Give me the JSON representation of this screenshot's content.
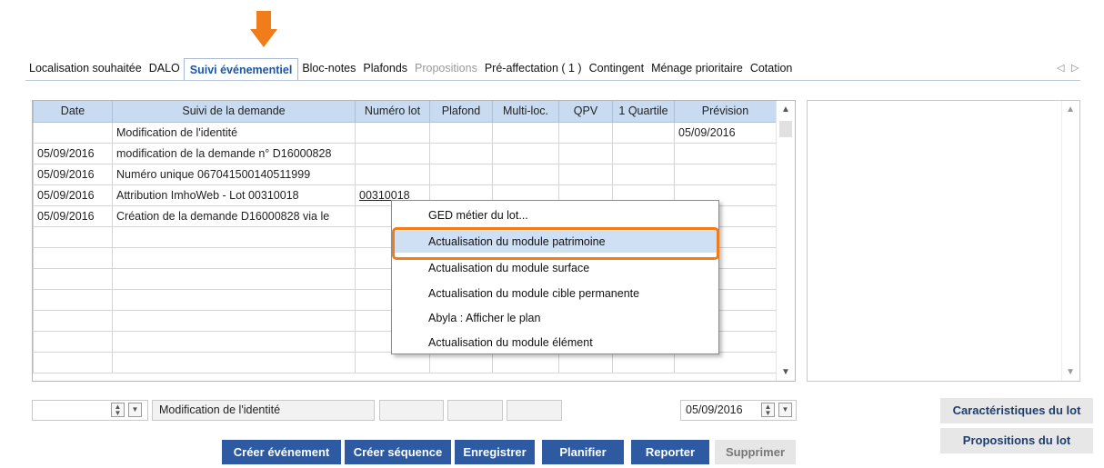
{
  "tabs": [
    {
      "label": "Localisation souhaitée",
      "state": "normal"
    },
    {
      "label": "DALO",
      "state": "normal"
    },
    {
      "label": "Suivi événementiel",
      "state": "active"
    },
    {
      "label": "Bloc-notes",
      "state": "normal"
    },
    {
      "label": "Plafonds",
      "state": "normal"
    },
    {
      "label": "Propositions",
      "state": "disabled"
    },
    {
      "label": "Pré-affectation ( 1 )",
      "state": "normal"
    },
    {
      "label": "Contingent",
      "state": "normal"
    },
    {
      "label": "Ménage prioritaire",
      "state": "normal"
    },
    {
      "label": "Cotation",
      "state": "normal"
    }
  ],
  "tab_nav": {
    "prev": "◁",
    "next": "▷"
  },
  "grid": {
    "columns": [
      "Date",
      "Suivi de la demande",
      "Numéro lot",
      "Plafond",
      "Multi-loc.",
      "QPV",
      "1 Quartile",
      "Prévision"
    ],
    "rows": [
      [
        "",
        "Modification de l'identité",
        "",
        "",
        "",
        "",
        "",
        "05/09/2016"
      ],
      [
        "05/09/2016",
        "modification de la demande n° D16000828",
        "",
        "",
        "",
        "",
        "",
        ""
      ],
      [
        "05/09/2016",
        "Numéro unique 067041500140511999",
        "",
        "",
        "",
        "",
        "",
        ""
      ],
      [
        "05/09/2016",
        "Attribution ImhoWeb - Lot 00310018",
        "00310018",
        "",
        "",
        "",
        "",
        ""
      ],
      [
        "05/09/2016",
        "Création de la demande D16000828 via le",
        "",
        "",
        "",
        "",
        "",
        ""
      ],
      [
        "",
        "",
        "",
        "",
        "",
        "",
        "",
        ""
      ],
      [
        "",
        "",
        "",
        "",
        "",
        "",
        "",
        ""
      ],
      [
        "",
        "",
        "",
        "",
        "",
        "",
        "",
        ""
      ],
      [
        "",
        "",
        "",
        "",
        "",
        "",
        "",
        ""
      ],
      [
        "",
        "",
        "",
        "",
        "",
        "",
        "",
        ""
      ],
      [
        "",
        "",
        "",
        "",
        "",
        "",
        "",
        ""
      ],
      [
        "",
        "",
        "",
        "",
        "",
        "",
        "",
        ""
      ]
    ]
  },
  "context_menu": {
    "items": [
      "GED métier du lot...",
      "Actualisation du module patrimoine",
      "Actualisation du module surface",
      "Actualisation du module cible permanente",
      "Abyla : Afficher le plan",
      "Actualisation du module élément"
    ],
    "highlighted_index": 1
  },
  "editor": {
    "date_value": "",
    "event_value": "Modification de l'identité",
    "prevision_value": "05/09/2016"
  },
  "buttons": {
    "create_event": "Créer événement",
    "create_sequence": "Créer séquence",
    "save": "Enregistrer",
    "plan": "Planifier",
    "postpone": "Reporter",
    "delete": "Supprimer"
  },
  "side_buttons": {
    "lot_characteristics": "Caractéristiques du lot",
    "lot_proposals": "Propositions du lot"
  },
  "colors": {
    "accent_orange": "#f07c1a",
    "button_blue": "#2d5aa0",
    "header_blue": "#c9dbf1",
    "active_tab": "#1b57a6"
  }
}
